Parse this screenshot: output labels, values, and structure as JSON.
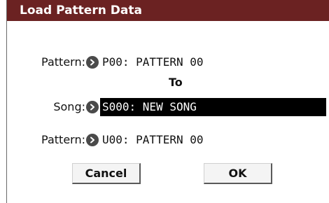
{
  "dialog": {
    "title": "Load Pattern Data"
  },
  "source_pattern": {
    "label": "Pattern:",
    "value": "P00: PATTERN 00"
  },
  "to_label": "To",
  "song": {
    "label": "Song:",
    "value": "S000: NEW SONG"
  },
  "dest_pattern": {
    "label": "Pattern:",
    "value": "U00: PATTERN 00"
  },
  "buttons": {
    "cancel": "Cancel",
    "ok": "OK"
  },
  "icons": {
    "popup": "chevron-right-icon"
  },
  "colors": {
    "title_bar": "#6b2222",
    "selected_field": "#000000",
    "popup_button": "#4a4a4a"
  }
}
